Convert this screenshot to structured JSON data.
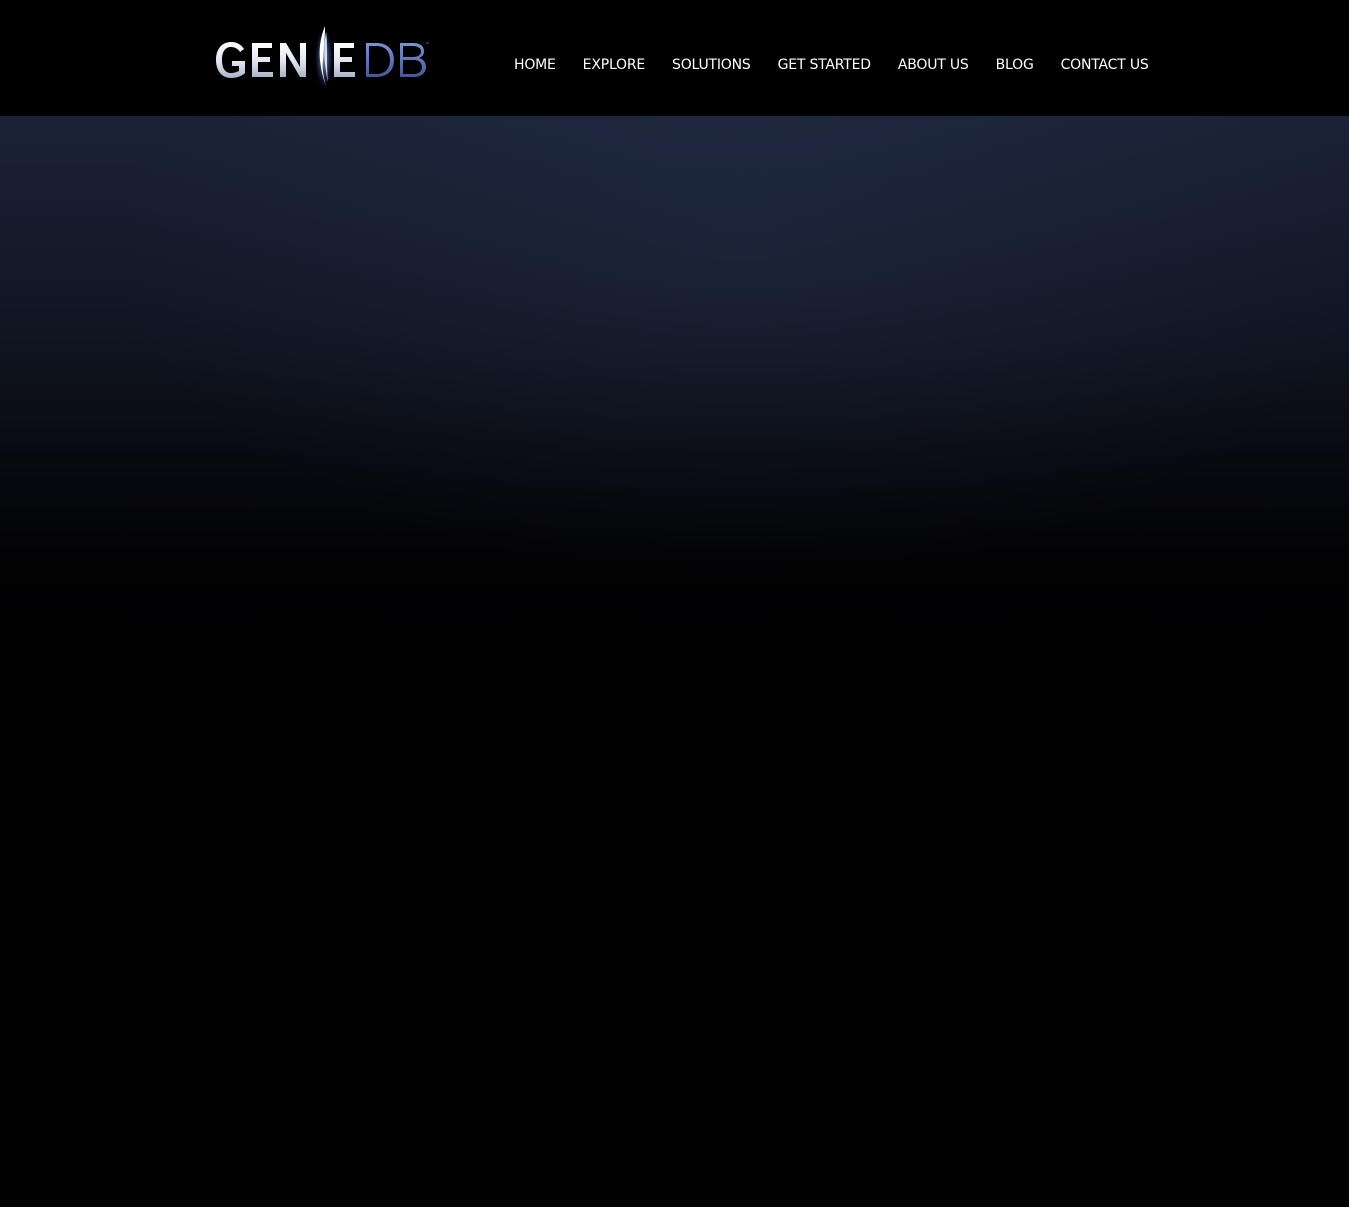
{
  "brand": {
    "logo_text_left": "GEN",
    "logo_text_right": "DB",
    "logo_full": "GENIEDB",
    "trademark": "™",
    "colors": {
      "logo_light": "#e8ecf5",
      "logo_blue": "#5a6fb0",
      "logo_glow": "#8fb3ff"
    }
  },
  "nav": {
    "items": [
      {
        "label": "HOME"
      },
      {
        "label": "EXPLORE"
      },
      {
        "label": "SOLUTIONS"
      },
      {
        "label": "GET STARTED"
      },
      {
        "label": "ABOUT US"
      },
      {
        "label": "BLOG"
      },
      {
        "label": "CONTACT US"
      }
    ]
  },
  "theme": {
    "header_bg": "#000000",
    "hero_top": "#1a2236",
    "page_bg": "#020203",
    "nav_text": "#ffffff"
  }
}
